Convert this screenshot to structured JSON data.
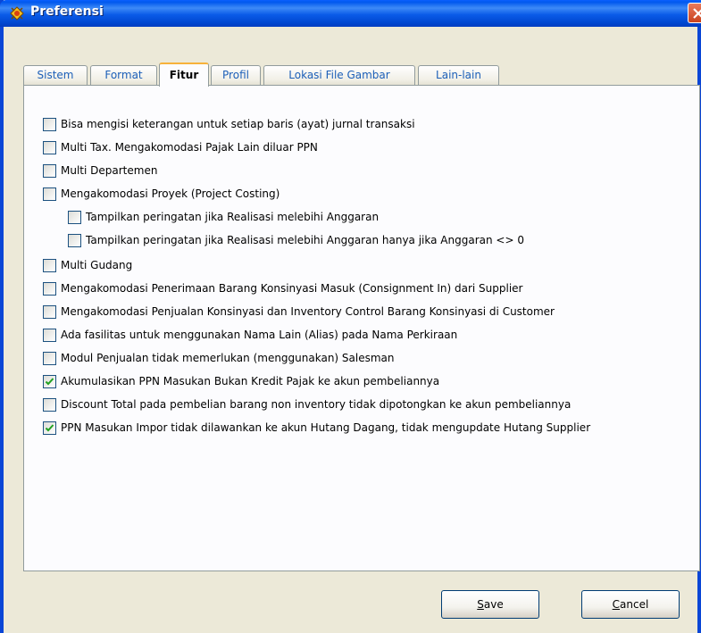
{
  "window": {
    "title": "Preferensi"
  },
  "tabs": [
    {
      "label": "Sistem",
      "active": false
    },
    {
      "label": "Format",
      "active": false
    },
    {
      "label": "Fitur",
      "active": true
    },
    {
      "label": "Profil",
      "active": false
    },
    {
      "label": "Lokasi File Gambar",
      "active": false
    },
    {
      "label": "Lain-lain",
      "active": false
    }
  ],
  "options": [
    {
      "label": "Bisa mengisi keterangan untuk setiap baris (ayat) jurnal transaksi",
      "checked": false
    },
    {
      "label": "Multi Tax. Mengakomodasi Pajak Lain diluar PPN",
      "checked": false
    },
    {
      "label": "Multi Departemen",
      "checked": false
    },
    {
      "label": "Mengakomodasi Proyek (Project Costing)",
      "checked": false
    },
    {
      "label": "Tampilkan peringatan jika Realisasi melebihi Anggaran",
      "checked": false
    },
    {
      "label": "Tampilkan peringatan jika Realisasi melebihi Anggaran hanya jika Anggaran <> 0",
      "checked": false
    },
    {
      "label": "Multi Gudang",
      "checked": false
    },
    {
      "label": "Mengakomodasi Penerimaan Barang Konsinyasi Masuk (Consignment In) dari Supplier",
      "checked": false
    },
    {
      "label": "Mengakomodasi Penjualan Konsinyasi dan Inventory Control Barang Konsinyasi di Customer",
      "checked": false
    },
    {
      "label": "Ada fasilitas untuk menggunakan Nama Lain (Alias) pada Nama Perkiraan",
      "checked": false
    },
    {
      "label": "Modul Penjualan tidak memerlukan (menggunakan) Salesman",
      "checked": false
    },
    {
      "label": "Akumulasikan PPN Masukan Bukan Kredit Pajak ke akun pembeliannya",
      "checked": true
    },
    {
      "label": "Discount Total pada pembelian barang non inventory tidak dipotongkan ke akun pembeliannya",
      "checked": false
    },
    {
      "label": "PPN Masukan Impor tidak dilawankan ke akun Hutang Dagang, tidak mengupdate Hutang Supplier",
      "checked": true
    }
  ],
  "buttons": {
    "save": {
      "mnemonic": "S",
      "rest": "ave"
    },
    "cancel": {
      "mnemonic": "C",
      "rest": "ancel"
    }
  },
  "colors": {
    "title_bar": "#0058ee",
    "check_mark": "#21a121",
    "active_tab_highlight": "#f7b23a"
  }
}
